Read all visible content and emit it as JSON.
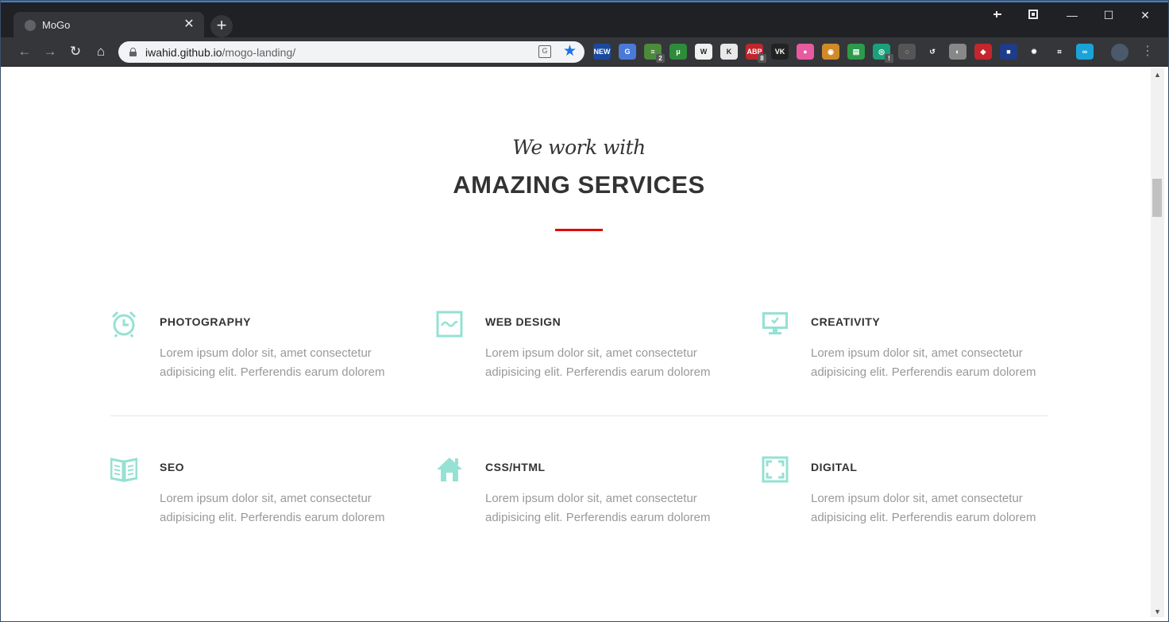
{
  "browser": {
    "tab_title": "MoGo",
    "tab_close": "✕",
    "new_tab": "+",
    "url_domain": "iwahid.github.io",
    "url_path": "/mogo-landing/",
    "window_controls": {
      "minimize": "—",
      "maximize": "☐",
      "close": "✕"
    },
    "extensions": [
      {
        "name": "new-ext-icon",
        "label": "NEW",
        "color": "#1a4aa0",
        "badge": ""
      },
      {
        "name": "google-translate-ext-icon",
        "label": "G",
        "color": "#4a7ad8",
        "badge": ""
      },
      {
        "name": "notes-ext-icon",
        "label": "≡",
        "color": "#4c8a3c",
        "badge": "2"
      },
      {
        "name": "utorrent-ext-icon",
        "label": "μ",
        "color": "#2e8b3a",
        "badge": ""
      },
      {
        "name": "wikipedia-ext-icon",
        "label": "W",
        "color": "#f0f0f0",
        "badge": ""
      },
      {
        "name": "k-ext-icon",
        "label": "K",
        "color": "#e8e8e8",
        "badge": ""
      },
      {
        "name": "abp-ext-icon",
        "label": "ABP",
        "color": "#c0262d",
        "badge": "8"
      },
      {
        "name": "vk-ext-icon",
        "label": "VK",
        "color": "#222",
        "badge": ""
      },
      {
        "name": "color-ext-icon",
        "label": "●",
        "color": "#e85aa0",
        "badge": ""
      },
      {
        "name": "owl-ext-icon",
        "label": "◉",
        "color": "#d08a2a",
        "badge": ""
      },
      {
        "name": "layers-ext-icon",
        "label": "▤",
        "color": "#2c9a4a",
        "badge": ""
      },
      {
        "name": "capture-ext-icon",
        "label": "◎",
        "color": "#1aa07a",
        "badge": "!"
      },
      {
        "name": "bulb-ext-icon",
        "label": "◌",
        "color": "#555",
        "badge": ""
      },
      {
        "name": "history-ext-icon",
        "label": "↺",
        "color": "#35363a",
        "badge": ""
      },
      {
        "name": "circle-ext-icon",
        "label": "◐",
        "color": "#888",
        "badge": ""
      },
      {
        "name": "angular-ext-icon",
        "label": "◆",
        "color": "#c4262d",
        "badge": ""
      },
      {
        "name": "square-ext-icon",
        "label": "■",
        "color": "#1e3c8a",
        "badge": ""
      },
      {
        "name": "settings-ext-icon",
        "label": "✹",
        "color": "#35363a",
        "badge": ""
      },
      {
        "name": "crop-ext-icon",
        "label": "⌗",
        "color": "#35363a",
        "badge": ""
      },
      {
        "name": "infinity-ext-icon",
        "label": "∞",
        "color": "#1aa3d8",
        "badge": ""
      }
    ],
    "menu": "⋮"
  },
  "page": {
    "subtitle": "We work with",
    "title": "AMAZING SERVICES",
    "accent_color": "#e00000",
    "icon_color": "#95e1d3",
    "services": [
      {
        "icon": "alarm-clock-icon",
        "title": "PHOTOGRAPHY",
        "text": "Lorem ipsum dolor sit, amet consectetur adipisicing elit. Perferendis earum dolorem"
      },
      {
        "icon": "chart-wave-icon",
        "title": "WEB DESIGN",
        "text": "Lorem ipsum dolor sit, amet consectetur adipisicing elit. Perferendis earum dolorem"
      },
      {
        "icon": "monitor-check-icon",
        "title": "CREATIVITY",
        "text": "Lorem ipsum dolor sit, amet consectetur adipisicing elit. Perferendis earum dolorem"
      },
      {
        "icon": "open-book-icon",
        "title": "SEO",
        "text": "Lorem ipsum dolor sit, amet consectetur adipisicing elit. Perferendis earum dolorem"
      },
      {
        "icon": "house-icon",
        "title": "CSS/HTML",
        "text": "Lorem ipsum dolor sit, amet consectetur adipisicing elit. Perferendis earum dolorem"
      },
      {
        "icon": "fullscreen-frame-icon",
        "title": "DIGITAL",
        "text": "Lorem ipsum dolor sit, amet consectetur adipisicing elit. Perferendis earum dolorem"
      }
    ]
  }
}
